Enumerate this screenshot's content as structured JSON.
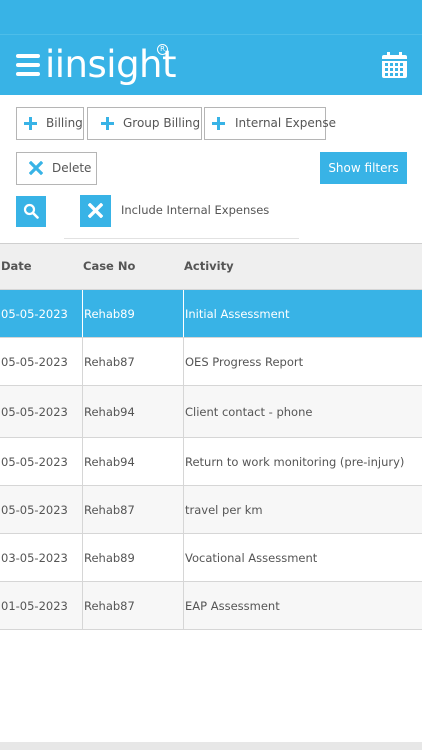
{
  "app": {
    "name": "iinsight",
    "registered_mark": "R"
  },
  "colors": {
    "accent": "#38b3e6",
    "border": "#b5b5b5",
    "text": "#555555"
  },
  "header": {
    "menu_icon": "hamburger-menu-icon",
    "calendar_icon": "calendar-icon"
  },
  "toolbar": {
    "billing_label": "Billing",
    "group_billing_label": "Group Billing",
    "internal_expense_label": "Internal Expense",
    "delete_label": "Delete",
    "show_filters_label": "Show filters"
  },
  "filters": {
    "search_icon": "search-icon",
    "include_internal_label": "Include Internal Expenses",
    "include_internal_icon": "x-toggle-icon"
  },
  "table": {
    "columns": [
      "Date",
      "Case No",
      "Activity"
    ],
    "selected_index": 0,
    "rows": [
      {
        "date": "05-05-2023",
        "case_no": "Rehab89",
        "activity": "Initial Assessment"
      },
      {
        "date": "05-05-2023",
        "case_no": "Rehab87",
        "activity": "OES Progress Report"
      },
      {
        "date": "05-05-2023",
        "case_no": "Rehab94",
        "activity": "Client contact - phone"
      },
      {
        "date": "05-05-2023",
        "case_no": "Rehab94",
        "activity": "Return to work monitoring (pre-injury)"
      },
      {
        "date": "05-05-2023",
        "case_no": "Rehab87",
        "activity": "travel per km"
      },
      {
        "date": "03-05-2023",
        "case_no": "Rehab89",
        "activity": "Vocational Assessment"
      },
      {
        "date": "01-05-2023",
        "case_no": "Rehab87",
        "activity": "EAP Assessment"
      }
    ]
  }
}
